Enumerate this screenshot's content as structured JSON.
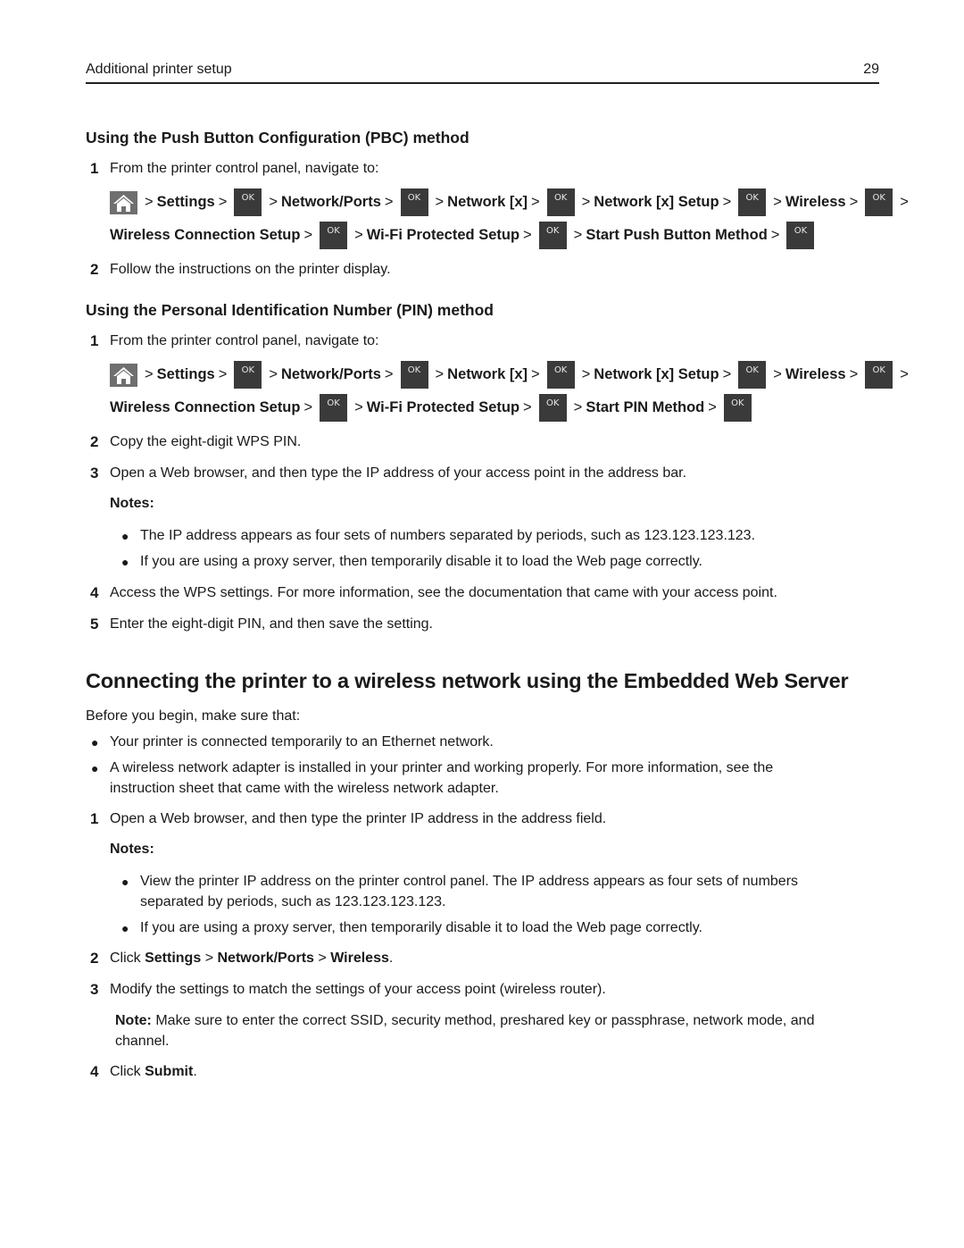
{
  "header": {
    "section": "Additional printer setup",
    "page": "29"
  },
  "pbc": {
    "title": "Using the Push Button Configuration (PBC) method",
    "step1": "From the printer control panel, navigate to:",
    "nav_line1": [
      "Settings",
      "Network/Ports",
      "Network [x]",
      "Network [x] Setup",
      "Wireless"
    ],
    "nav_line2": [
      "Wireless Connection Setup",
      "Wi-Fi Protected Setup",
      "Start Push Button Method"
    ],
    "step2": "Follow the instructions on the printer display."
  },
  "pin": {
    "title": "Using the Personal Identification Number (PIN) method",
    "step1": "From the printer control panel, navigate to:",
    "nav_line1": [
      "Settings",
      "Network/Ports",
      "Network [x]",
      "Network [x] Setup",
      "Wireless"
    ],
    "nav_line2": [
      "Wireless Connection Setup",
      "Wi-Fi Protected Setup",
      "Start PIN Method"
    ],
    "step2": "Copy the eight-digit WPS PIN.",
    "step3": "Open a Web browser, and then type the IP address of your access point in the address bar.",
    "notes_label": "Notes:",
    "notes": [
      "The IP address appears as four sets of numbers separated by periods, such as 123.123.123.123.",
      "If you are using a proxy server, then temporarily disable it to load the Web page correctly."
    ],
    "step4": "Access the WPS settings. For more information, see the documentation that came with your access point.",
    "step5": "Enter the eight-digit PIN, and then save the setting."
  },
  "ews": {
    "title": "Connecting the printer to a wireless network using the Embedded Web Server",
    "intro": "Before you begin, make sure that:",
    "prereqs": [
      "Your printer is connected temporarily to an Ethernet network.",
      "A wireless network adapter is installed in your printer and working properly. For more information, see the",
      "instruction sheet that came with the wireless network adapter."
    ],
    "step1": "Open a Web browser, and then type the printer IP address in the address field.",
    "notes_label": "Notes:",
    "notes": [
      "View the printer IP address on the printer control panel. The IP address appears as four sets of numbers",
      "separated by periods, such as 123.123.123.123.",
      "If you are using a proxy server, then temporarily disable it to load the Web page correctly."
    ],
    "step2_prefix": "Click ",
    "step2_path": [
      "Settings",
      "Network/Ports",
      "Wireless"
    ],
    "step3": "Modify the settings to match the settings of your access point (wireless router).",
    "note_label": "Note:",
    "note_text": " Make sure to enter the correct SSID, security method, preshared key or passphrase, network mode, and",
    "note_text2": "channel.",
    "step4_prefix": "Click ",
    "step4_bold": "Submit"
  },
  "common": {
    "ok_label": "OK",
    "sep": ">",
    "period": "."
  }
}
